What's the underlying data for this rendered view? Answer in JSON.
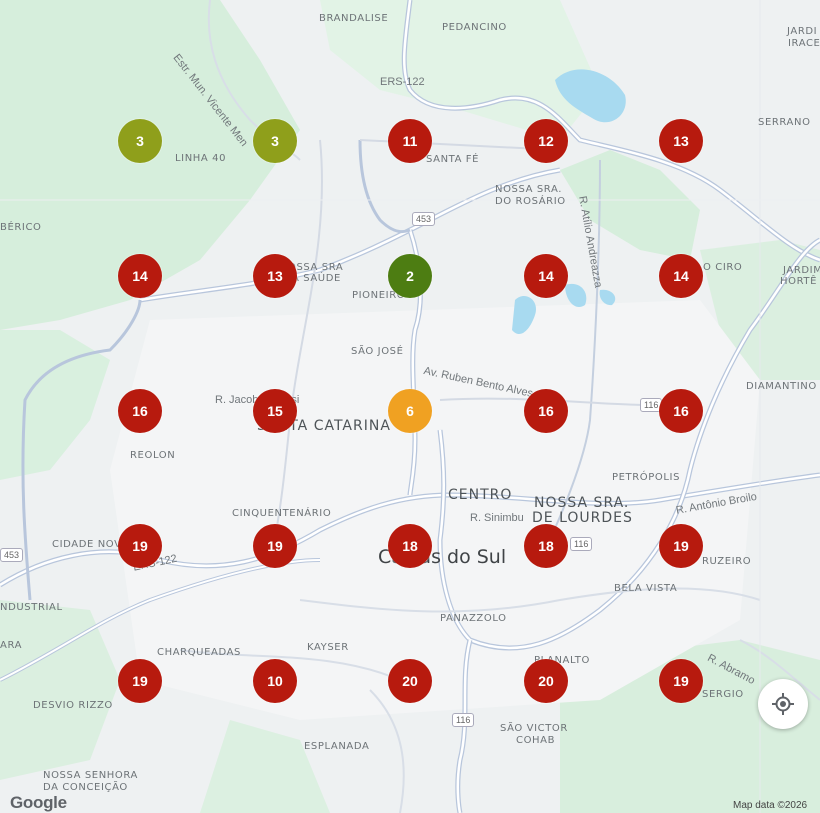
{
  "map": {
    "places": [
      {
        "name": "BRANDALISE",
        "cls": ""
      },
      {
        "name": "PEDANCINO",
        "cls": ""
      },
      {
        "name": "LINHA 40",
        "cls": ""
      },
      {
        "name": "SANTA FÉ",
        "cls": ""
      },
      {
        "name": "NOSSA SRA.",
        "cls": ""
      },
      {
        "name": "DO ROSÁRIO",
        "cls": ""
      },
      {
        "name": "SERRANO",
        "cls": ""
      },
      {
        "name": "BÉRICO",
        "cls": ""
      },
      {
        "name": "OSSA SRA",
        "cls": ""
      },
      {
        "name": "A SAÚDE",
        "cls": ""
      },
      {
        "name": "PIONEIRO",
        "cls": ""
      },
      {
        "name": "O CIRO",
        "cls": ""
      },
      {
        "name": "JARDIM",
        "cls": ""
      },
      {
        "name": "HORTÊ",
        "cls": ""
      },
      {
        "name": "SÃO JOSÉ",
        "cls": ""
      },
      {
        "name": "DIAMANTINO",
        "cls": ""
      },
      {
        "name": "REOLON",
        "cls": ""
      },
      {
        "name": "PETRÓPOLIS",
        "cls": ""
      },
      {
        "name": "CINQUENTENÁRIO",
        "cls": ""
      },
      {
        "name": "CIDADE NOV",
        "cls": ""
      },
      {
        "name": "BELA VISTA",
        "cls": ""
      },
      {
        "name": "RUZEIRO",
        "cls": ""
      },
      {
        "name": "NDUSTRIAL",
        "cls": ""
      },
      {
        "name": "CHARQUEADAS",
        "cls": ""
      },
      {
        "name": "KAYSER",
        "cls": ""
      },
      {
        "name": "PANAZZOLO",
        "cls": ""
      },
      {
        "name": "PLANALTO",
        "cls": ""
      },
      {
        "name": "DESVIO RIZZO",
        "cls": ""
      },
      {
        "name": "SÃO VICTOR",
        "cls": ""
      },
      {
        "name": "COHAB",
        "cls": ""
      },
      {
        "name": "ESPLANADA",
        "cls": ""
      },
      {
        "name": "NOSSA SENHORA",
        "cls": ""
      },
      {
        "name": "DA CONCEIÇÃO",
        "cls": ""
      },
      {
        "name": "SERGIO",
        "cls": ""
      },
      {
        "name": "ARA",
        "cls": ""
      },
      {
        "name": "JARDI",
        "cls": ""
      },
      {
        "name": "IRACE",
        "cls": ""
      },
      {
        "name": "CENTRO",
        "cls": "big"
      },
      {
        "name": "NOSSA SRA.",
        "cls": "big"
      },
      {
        "name": "DE LOURDES",
        "cls": "big"
      },
      {
        "name": "SANTA CATARINA",
        "cls": "big"
      },
      {
        "name": "Caxias do Sul",
        "cls": "city"
      }
    ],
    "streets": [
      {
        "name": "Estr. Mun. Vicente Men",
        "rot": 52
      },
      {
        "name": "ERS-122",
        "rot": 0
      },
      {
        "name": "R. Atílio Andreazza",
        "rot": 80
      },
      {
        "name": "Av. Ruben Bento Alves",
        "rot": 12
      },
      {
        "name": "R. Jacob Luchesi",
        "rot": 0
      },
      {
        "name": "R. Sinimbu",
        "rot": 0
      },
      {
        "name": "R. Antônio Broilo",
        "rot": -10
      },
      {
        "name": "ERS-122",
        "rot": -12
      },
      {
        "name": "R. Abramo",
        "rot": 28
      }
    ],
    "shields": [
      "453",
      "116",
      "116",
      "453",
      "116"
    ]
  },
  "markers": [
    {
      "label": "3",
      "color": "#8f9f1b"
    },
    {
      "label": "3",
      "color": "#8f9f1b"
    },
    {
      "label": "11",
      "color": "#b71a0e"
    },
    {
      "label": "12",
      "color": "#b71a0e"
    },
    {
      "label": "13",
      "color": "#b71a0e"
    },
    {
      "label": "14",
      "color": "#b71a0e"
    },
    {
      "label": "13",
      "color": "#b71a0e"
    },
    {
      "label": "2",
      "color": "#4d7d12"
    },
    {
      "label": "14",
      "color": "#b71a0e"
    },
    {
      "label": "14",
      "color": "#b71a0e"
    },
    {
      "label": "16",
      "color": "#b71a0e"
    },
    {
      "label": "15",
      "color": "#b71a0e"
    },
    {
      "label": "6",
      "color": "#f0a122"
    },
    {
      "label": "16",
      "color": "#b71a0e"
    },
    {
      "label": "16",
      "color": "#b71a0e"
    },
    {
      "label": "19",
      "color": "#b71a0e"
    },
    {
      "label": "19",
      "color": "#b71a0e"
    },
    {
      "label": "18",
      "color": "#b71a0e"
    },
    {
      "label": "18",
      "color": "#b71a0e"
    },
    {
      "label": "19",
      "color": "#b71a0e"
    },
    {
      "label": "19",
      "color": "#b71a0e"
    },
    {
      "label": "10",
      "color": "#b71a0e"
    },
    {
      "label": "20",
      "color": "#b71a0e"
    },
    {
      "label": "20",
      "color": "#b71a0e"
    },
    {
      "label": "19",
      "color": "#b71a0e"
    }
  ],
  "controls": {
    "locate_icon": "crosshair-icon",
    "logo": "Google",
    "attribution": "Map data ©2026"
  },
  "colors": {
    "water": "#a8daf0",
    "park": "#cdebd6",
    "road": "#ffffff",
    "highway": "#b8c6dc"
  }
}
